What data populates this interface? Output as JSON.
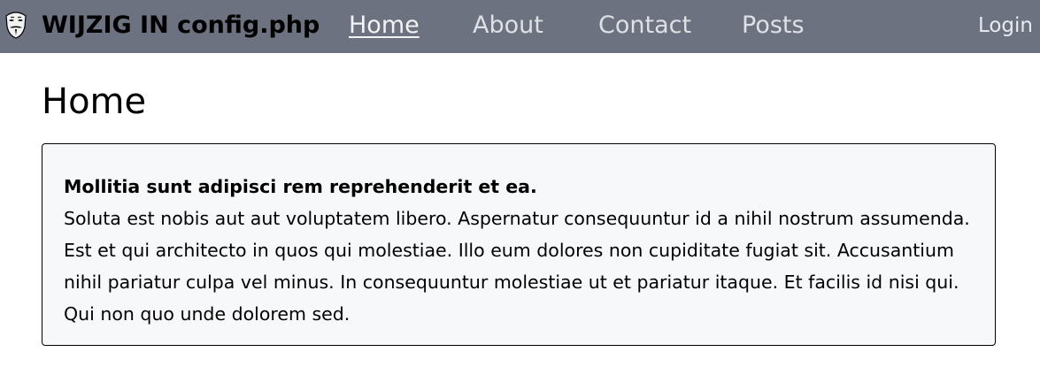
{
  "navbar": {
    "logo_icon": "guy-fawkes-mask-icon",
    "brand": "WIJZIG IN config.php",
    "links": [
      {
        "label": "Home",
        "active": true
      },
      {
        "label": "About",
        "active": false
      },
      {
        "label": "Contact",
        "active": false
      },
      {
        "label": "Posts",
        "active": false
      }
    ],
    "login": "Login",
    "background_color": "#6c7280"
  },
  "main": {
    "title": "Home",
    "post": {
      "title": "Mollitia sunt adipisci rem reprehenderit et ea.",
      "body": "Soluta est nobis aut aut voluptatem libero. Aspernatur consequuntur id a nihil nostrum assumenda. Est et qui architecto in quos qui molestiae. Illo eum dolores non cupiditate fugiat sit. Accusantium nihil pariatur culpa vel minus. In consequuntur molestiae ut et pariatur itaque. Et facilis id nisi qui. Qui non quo unde dolorem sed."
    }
  }
}
